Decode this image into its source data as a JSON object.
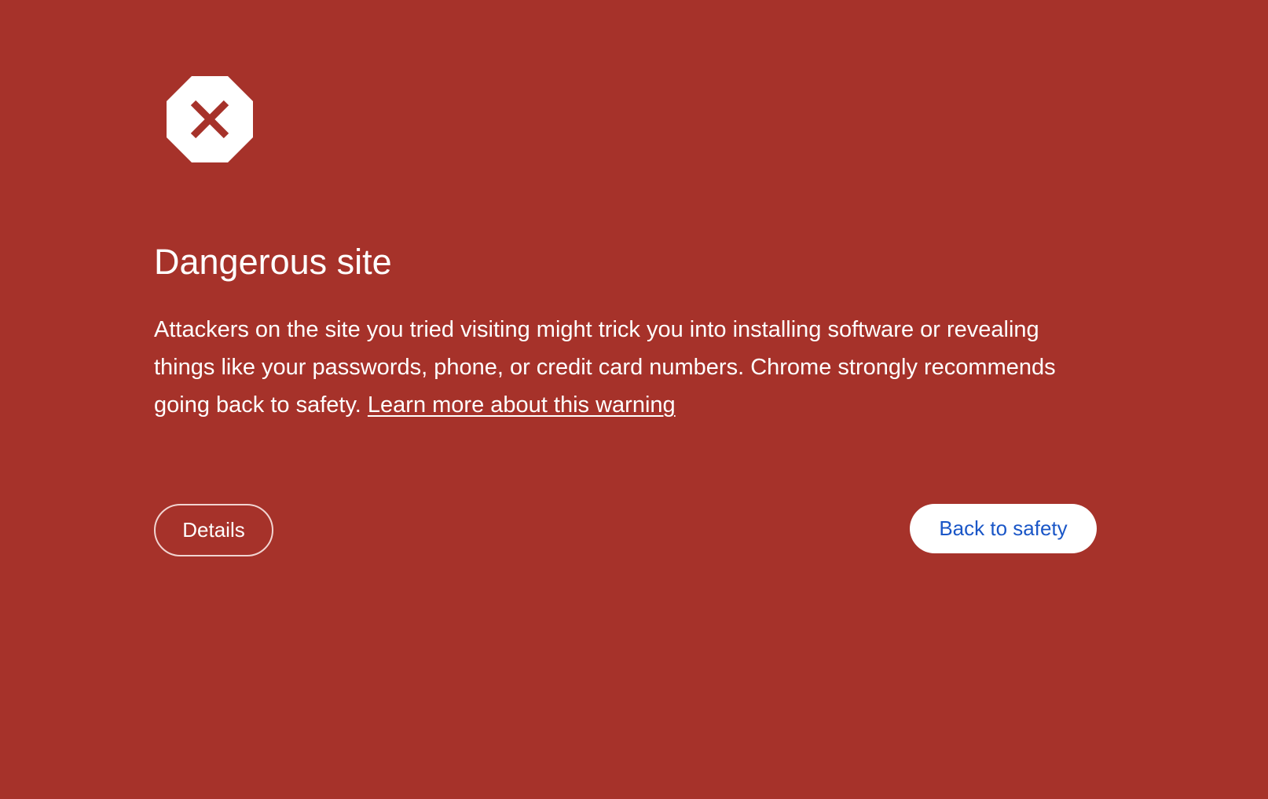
{
  "colors": {
    "background": "#a6322a",
    "text": "#ffffff",
    "primary_button_text": "#1a56c7",
    "primary_button_bg": "#ffffff"
  },
  "icon": "stop-sign-x-icon",
  "title": "Dangerous site",
  "body": {
    "text": "Attackers on the site you tried visiting might trick you into installing software or revealing things like your passwords, phone, or credit card numbers. Chrome strongly recommends going back to safety.",
    "link_label": "Learn more about this warning"
  },
  "buttons": {
    "details_label": "Details",
    "back_label": "Back to safety"
  }
}
